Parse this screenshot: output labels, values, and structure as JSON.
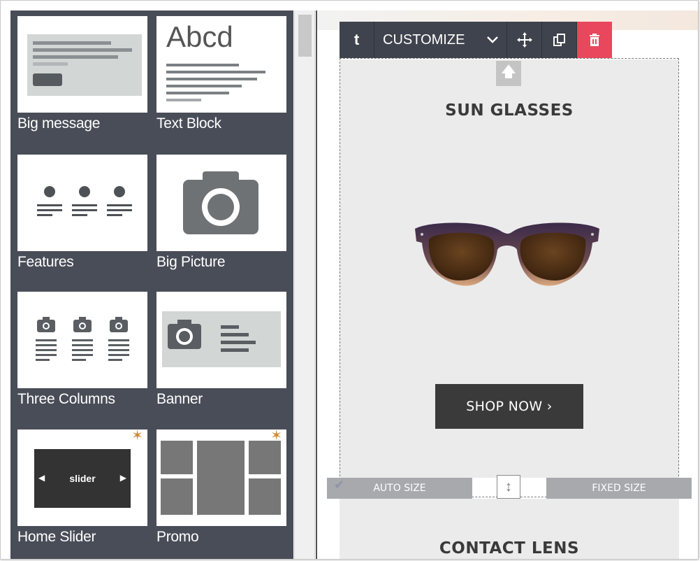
{
  "blocks": [
    {
      "label": "Big message",
      "icon": "big-message-thumbnail"
    },
    {
      "label": "Text Block",
      "icon": "text-block-thumbnail",
      "thumb_text": "Abcd"
    },
    {
      "label": "Features",
      "icon": "features-thumbnail"
    },
    {
      "label": "Big Picture",
      "icon": "camera-thumbnail"
    },
    {
      "label": "Three Columns",
      "icon": "three-columns-thumbnail"
    },
    {
      "label": "Banner",
      "icon": "banner-thumbnail"
    },
    {
      "label": "Home Slider",
      "icon": "slider-thumbnail",
      "thumb_text": "slider"
    },
    {
      "label": "Promo",
      "icon": "promo-thumbnail"
    }
  ],
  "toolbar": {
    "up_label": "t",
    "customize_label": "CUSTOMIZE",
    "icons": [
      "parent-arrow-icon",
      "chevron-down-icon",
      "move-icon",
      "copy-icon",
      "trash-icon"
    ]
  },
  "product": {
    "title": "SUN GLASSES",
    "button": "SHOP NOW ›"
  },
  "size_controls": {
    "auto": "AUTO SIZE",
    "fixed": "FIXED SIZE"
  },
  "next_block": {
    "title": "CONTACT LENS"
  },
  "colors": {
    "sidebar": "#494d57",
    "toolbar": "#3f434d",
    "delete": "#e8475d",
    "block_bg": "#ebebeb",
    "button": "#3a3a3a"
  }
}
